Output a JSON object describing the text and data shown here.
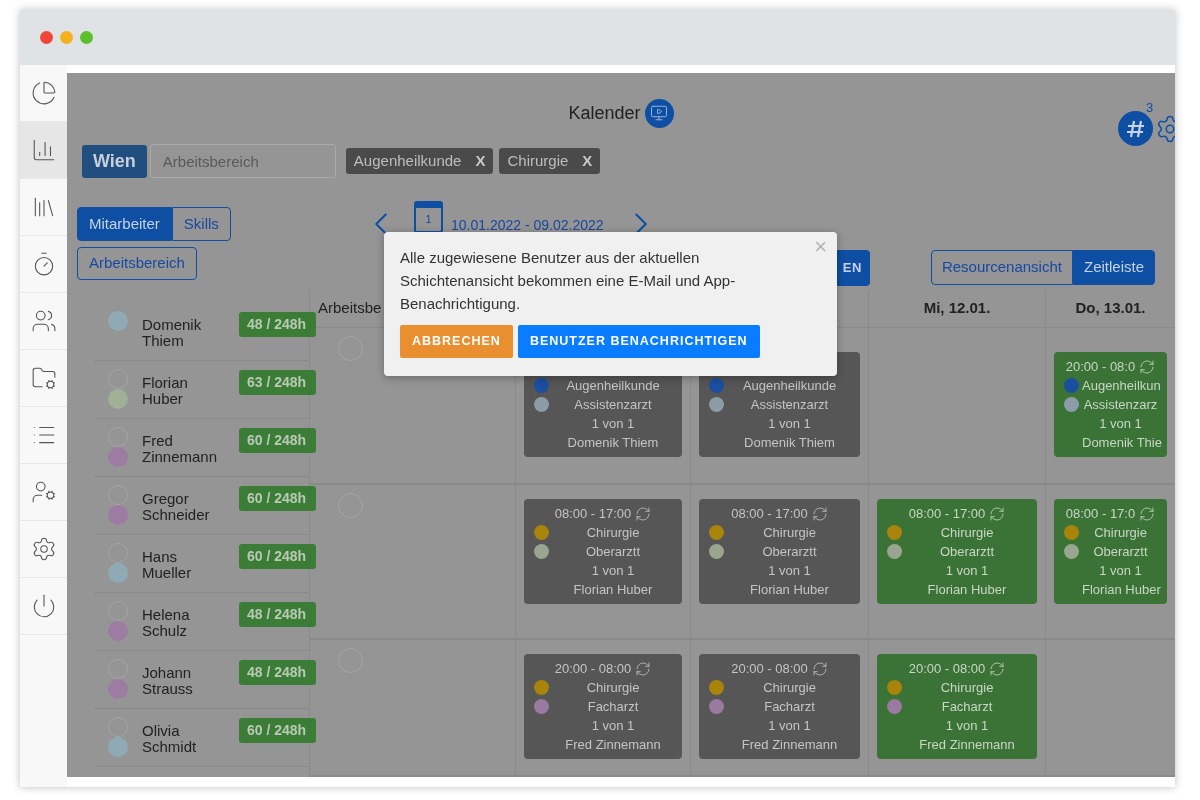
{
  "sidebar": {
    "items": [
      {
        "selected": false
      },
      {
        "selected": true
      },
      {
        "selected": false
      },
      {
        "selected": false
      },
      {
        "selected": false
      },
      {
        "selected": false
      },
      {
        "selected": false
      },
      {
        "selected": false
      },
      {
        "selected": false
      },
      {
        "selected": false
      }
    ]
  },
  "header": {
    "title": "Kalender",
    "badge": "3"
  },
  "filters": {
    "location": "Wien",
    "area_placeholder": "Arbeitsbereich",
    "chips": [
      {
        "label": "Augenheilkunde",
        "remove": "X"
      },
      {
        "label": "Chirurgie",
        "remove": "X"
      }
    ]
  },
  "view_tabs": [
    {
      "label": "Mitarbeiter",
      "selected": true
    },
    {
      "label": "Skills",
      "selected": false
    }
  ],
  "area_button": "Arbeitsbereich",
  "date_nav": {
    "day": "1",
    "range": "10.01.2022 - 09.02.2022"
  },
  "hidden_button": "EN",
  "mode_tabs": [
    {
      "label": "Resourcenansicht",
      "selected": false
    },
    {
      "label": "Zeitleiste",
      "selected": true
    }
  ],
  "employees": [
    {
      "first": "Domenik",
      "last": "Thiem",
      "hours": "48 / 248h",
      "kind": "single",
      "color": "#8fa9b5"
    },
    {
      "first": "Florian",
      "last": "Huber",
      "hours": "63 / 248h",
      "kind": "double",
      "color": "#9fb094"
    },
    {
      "first": "Fred",
      "last": "Zinnemann",
      "hours": "60 / 248h",
      "kind": "double",
      "color": "#9c7ca2"
    },
    {
      "first": "Gregor",
      "last": "Schneider",
      "hours": "60 / 248h",
      "kind": "double",
      "color": "#9c7ca2"
    },
    {
      "first": "Hans",
      "last": "Mueller",
      "hours": "60 / 248h",
      "kind": "double",
      "color": "#8fa9b5"
    },
    {
      "first": "Helena",
      "last": "Schulz",
      "hours": "48 / 248h",
      "kind": "double",
      "color": "#9c7ca2"
    },
    {
      "first": "Johann",
      "last": "Strauss",
      "hours": "48 / 248h",
      "kind": "double",
      "color": "#9c7ca2"
    },
    {
      "first": "Olivia",
      "last": "Schmidt",
      "hours": "60 / 248h",
      "kind": "double",
      "color": "#8fa9b5"
    }
  ],
  "grid": {
    "area_column": "Arbeitsbe",
    "columns": [
      "",
      "",
      "Mi, 12.01.",
      "Do, 13.01."
    ],
    "rows": [
      {
        "cells": [
          {
            "confirmed": false,
            "dept": {
              "label": "Augenheilkunde",
              "color": "#1a4fa0"
            },
            "role": {
              "label": "Assistenzarzt",
              "color": "#8c9ca6"
            },
            "count": "1 von 1",
            "person": "Domenik Thiem"
          },
          {
            "confirmed": false,
            "dept": {
              "label": "Augenheilkunde",
              "color": "#1a4fa0"
            },
            "role": {
              "label": "Assistenzarzt",
              "color": "#8c9ca6"
            },
            "count": "1 von 1",
            "person": "Domenik Thiem"
          },
          null,
          {
            "confirmed": true,
            "time": "20:00 - 08:0",
            "dept": {
              "label": "Augenheilkun",
              "color": "#1a4fa0"
            },
            "role": {
              "label": "Assistenzarz",
              "color": "#8c9ca6"
            },
            "count": "1 von 1",
            "person": "Domenik Thie"
          }
        ]
      },
      {
        "cells": [
          {
            "confirmed": false,
            "time": "08:00 - 17:00",
            "dept": {
              "label": "Chirurgie",
              "color": "#a8840a"
            },
            "role": {
              "label": "Oberarztt",
              "color": "#9aa590"
            },
            "count": "1 von 1",
            "person": "Florian Huber"
          },
          {
            "confirmed": false,
            "time": "08:00 - 17:00",
            "dept": {
              "label": "Chirurgie",
              "color": "#a8840a"
            },
            "role": {
              "label": "Oberarztt",
              "color": "#9aa590"
            },
            "count": "1 von 1",
            "person": "Florian Huber"
          },
          {
            "confirmed": true,
            "time": "08:00 - 17:00",
            "dept": {
              "label": "Chirurgie",
              "color": "#a8840a"
            },
            "role": {
              "label": "Oberarztt",
              "color": "#9aa590"
            },
            "count": "1 von 1",
            "person": "Florian Huber"
          },
          {
            "confirmed": true,
            "time": "08:00 - 17:0",
            "dept": {
              "label": "Chirurgie",
              "color": "#a8840a"
            },
            "role": {
              "label": "Oberarztt",
              "color": "#9aa590"
            },
            "count": "1 von 1",
            "person": "Florian Huber"
          }
        ]
      },
      {
        "cells": [
          {
            "confirmed": false,
            "time": "20:00 - 08:00",
            "dept": {
              "label": "Chirurgie",
              "color": "#a8840a"
            },
            "role": {
              "label": "Facharzt",
              "color": "#9a7aa0"
            },
            "count": "1 von 1",
            "person": "Fred Zinnemann"
          },
          {
            "confirmed": false,
            "time": "20:00 - 08:00",
            "dept": {
              "label": "Chirurgie",
              "color": "#a8840a"
            },
            "role": {
              "label": "Facharzt",
              "color": "#9a7aa0"
            },
            "count": "1 von 1",
            "person": "Fred Zinnemann"
          },
          {
            "confirmed": true,
            "time": "20:00 - 08:00",
            "dept": {
              "label": "Chirurgie",
              "color": "#a8840a"
            },
            "role": {
              "label": "Facharzt",
              "color": "#9a7aa0"
            },
            "count": "1 von 1",
            "person": "Fred Zinnemann"
          },
          null
        ]
      }
    ]
  },
  "dialog": {
    "message": "Alle zugewiesene Benutzer aus der aktuellen Schichtenansicht bekommen eine E-Mail und App-Benachrichtigung.",
    "close": "×",
    "cancel": "ABBRECHEN",
    "confirm": "BENUTZER BENACHRICHTIGEN"
  }
}
